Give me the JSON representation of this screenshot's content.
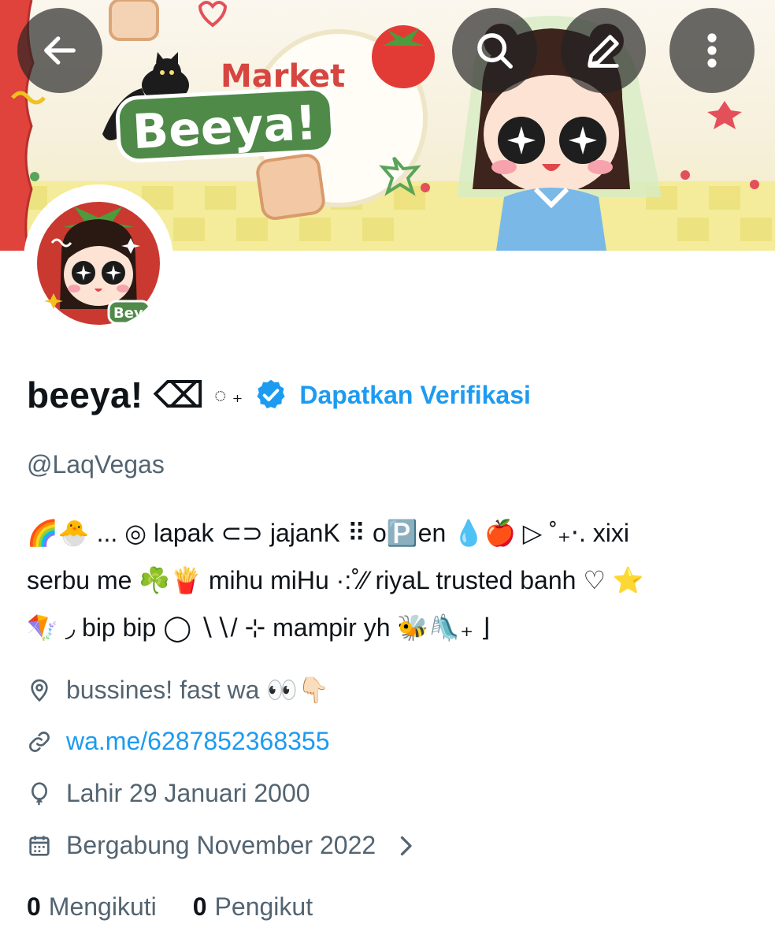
{
  "header": {
    "back_icon": "arrow-left-icon",
    "search_icon": "search-icon",
    "edit_icon": "pencil-icon",
    "more_icon": "more-vertical-icon"
  },
  "banner": {
    "title_small": "Market",
    "title_big": "Beeya!"
  },
  "avatar": {
    "tag": "Bey"
  },
  "profile": {
    "display_name": "beeya! ⌫",
    "name_suffix": "◌ ₊",
    "verified_badge_icon": "verified-badge-icon",
    "get_verified_label": "Dapatkan Verifikasi",
    "handle": "@LaqVegas",
    "bio_lines": [
      "🌈🐣 ... ◎ lapak ⊂⊃ jajanK ⠿ o🅿️en 💧🍎 ▷ ˚₊‧. xixi",
      "serbu me ☘️🍟 mihu miHu ·:˚⁄⁄ riyaL trusted banh ♡ ⭐",
      "🪁 ◞ bip bip ◯ ∖∖/ ⊹ mampir yh 🐝🛝₊ ⌋"
    ],
    "location": "bussines! fast wa 👀👇🏻",
    "link": "wa.me/6287852368355",
    "birth": "Lahir 29 Januari 2000",
    "joined": "Bergabung November 2022",
    "following_count": "0",
    "following_label": "Mengikuti",
    "followers_count": "0",
    "followers_label": "Pengikut"
  },
  "colors": {
    "accent": "#1d9bf0",
    "text_primary": "#0f1419",
    "text_secondary": "#536471"
  }
}
